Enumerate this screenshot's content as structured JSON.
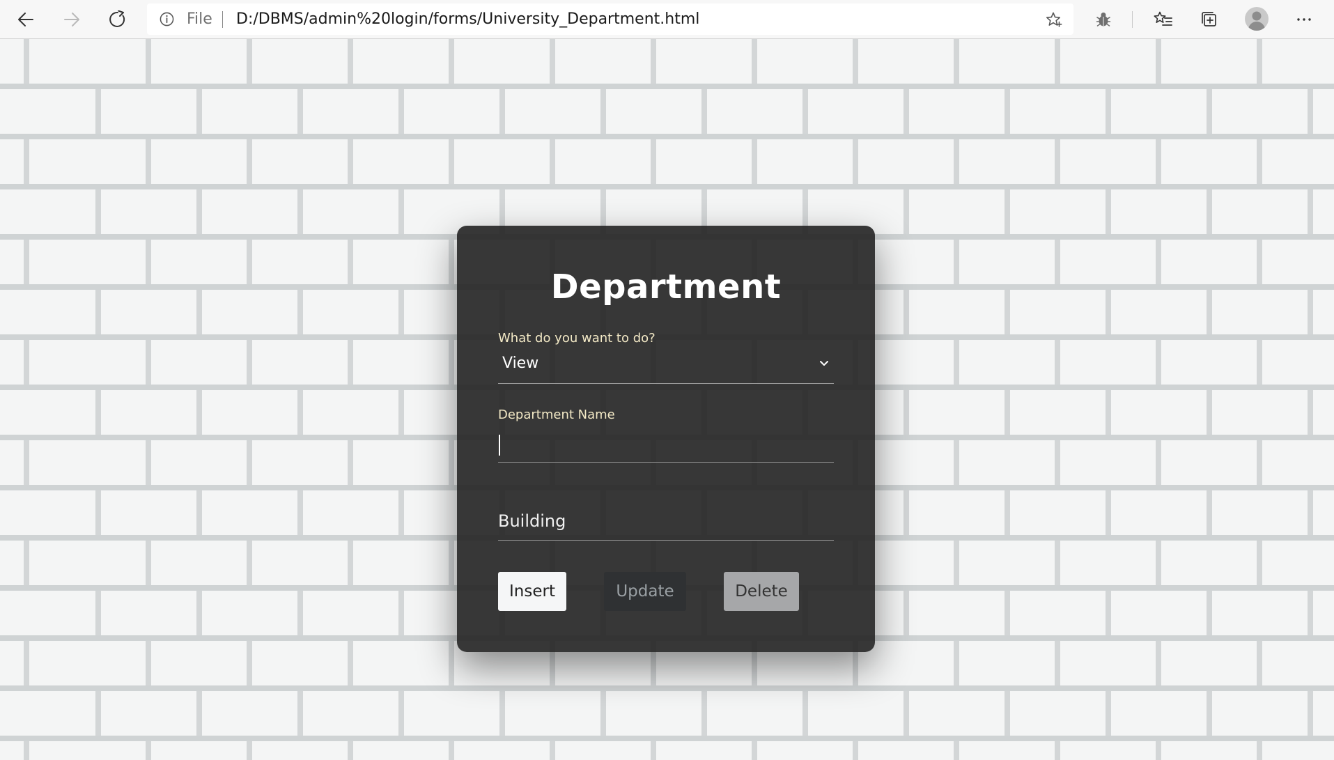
{
  "browser": {
    "scheme_label": "File",
    "url": "D:/DBMS/admin%20login/forms/University_Department.html"
  },
  "form": {
    "title": "Department",
    "action_label": "What do you want to do?",
    "action_value": "View",
    "department_name_label": "Department Name",
    "department_name_value": "",
    "building_placeholder": "Building",
    "buttons": {
      "insert": "Insert",
      "update": "Update",
      "delete": "Delete"
    }
  },
  "colors": {
    "card_bg": "#282828",
    "label_color": "#f3e9c6",
    "insert_bg": "#f5f6f7",
    "update_bg": "#2f3133",
    "delete_bg": "#a6a7a9"
  },
  "icons": {
    "back": "arrow-left-icon",
    "forward": "arrow-right-icon",
    "refresh": "refresh-icon",
    "info": "info-icon",
    "favorite": "star-add-icon",
    "extension": "bug-icon",
    "favorites": "favorites-icon",
    "collections": "collections-icon",
    "profile": "profile-avatar-icon",
    "menu": "more-horizontal-icon",
    "dropdown": "chevron-down-icon"
  }
}
